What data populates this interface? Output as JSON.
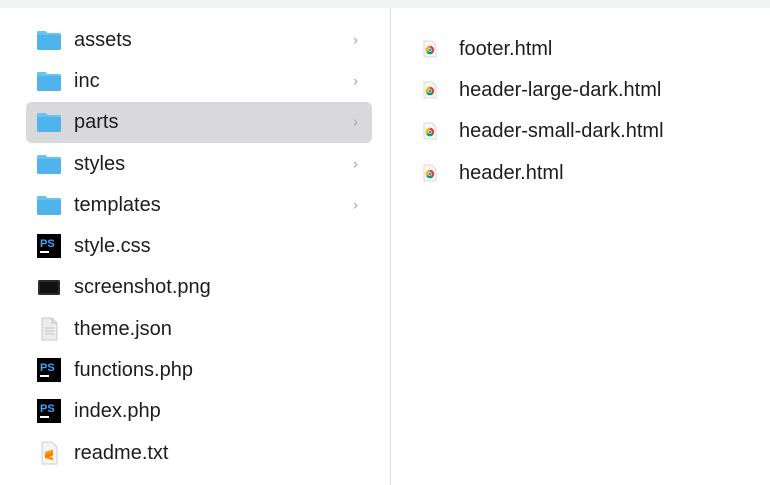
{
  "left_column": {
    "items": [
      {
        "label": "assets",
        "icon": "folder-icon",
        "kind": "folder"
      },
      {
        "label": "inc",
        "icon": "folder-icon",
        "kind": "folder"
      },
      {
        "label": "parts",
        "icon": "folder-icon",
        "kind": "folder",
        "selected": true
      },
      {
        "label": "styles",
        "icon": "folder-icon",
        "kind": "folder"
      },
      {
        "label": "templates",
        "icon": "folder-icon",
        "kind": "folder"
      },
      {
        "label": "style.css",
        "icon": "phpstorm-file-icon",
        "kind": "ps"
      },
      {
        "label": "screenshot.png",
        "icon": "image-file-icon",
        "kind": "png"
      },
      {
        "label": "theme.json",
        "icon": "generic-document-icon",
        "kind": "doc"
      },
      {
        "label": "functions.php",
        "icon": "phpstorm-file-icon",
        "kind": "ps"
      },
      {
        "label": "index.php",
        "icon": "phpstorm-file-icon",
        "kind": "ps"
      },
      {
        "label": "readme.txt",
        "icon": "sublime-text-file-icon",
        "kind": "txt"
      }
    ],
    "chevron": "›"
  },
  "right_column": {
    "items": [
      {
        "label": "footer.html",
        "icon": "chrome-html-file-icon"
      },
      {
        "label": "header-large-dark.html",
        "icon": "chrome-html-file-icon"
      },
      {
        "label": "header-small-dark.html",
        "icon": "chrome-html-file-icon"
      },
      {
        "label": "header.html",
        "icon": "chrome-html-file-icon"
      }
    ]
  },
  "colors": {
    "folder": "#4fb3ec",
    "folder_tab": "#69c1f0",
    "selection": "#d9d9db",
    "ps_bg": "#000000",
    "ps_text": "#3ea6ff"
  }
}
